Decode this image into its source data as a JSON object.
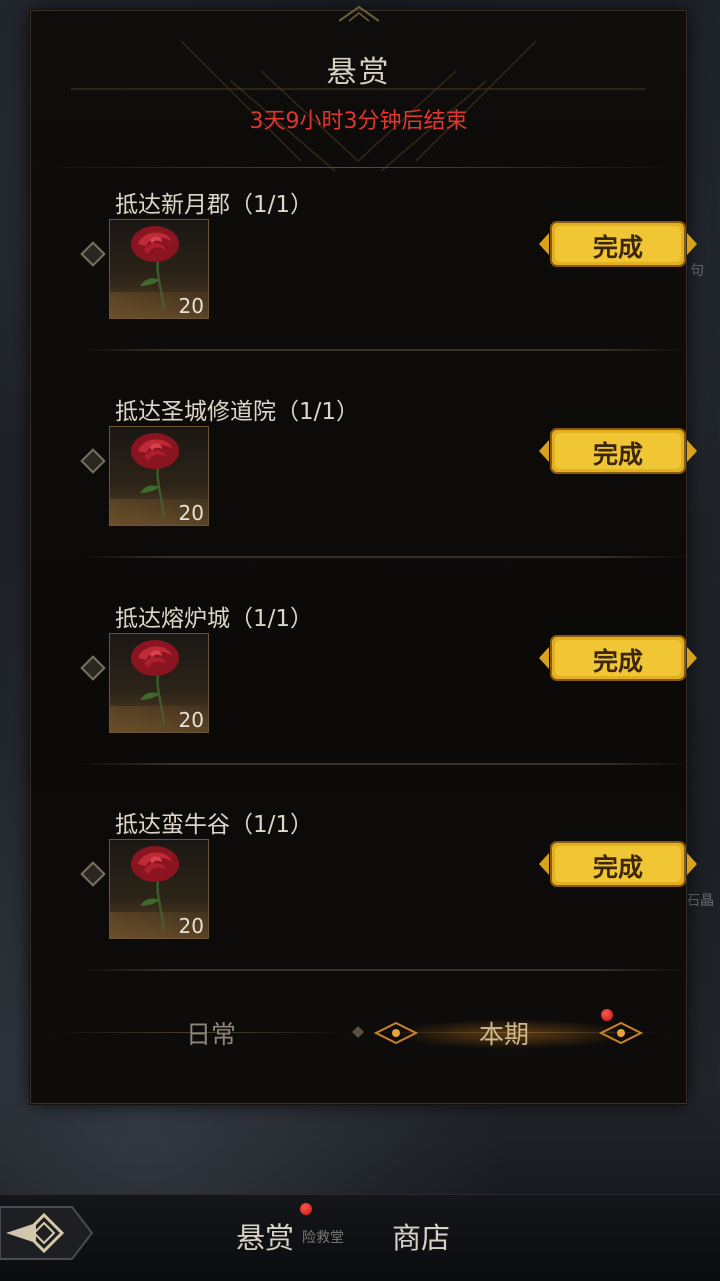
{
  "panel": {
    "title": "悬赏",
    "countdown": "3天9小时3分钟后结束"
  },
  "tasks": [
    {
      "name": "抵达新月郡（1/1）",
      "reward_qty": "20",
      "button": "完成"
    },
    {
      "name": "抵达圣城修道院（1/1）",
      "reward_qty": "20",
      "button": "完成"
    },
    {
      "name": "抵达熔炉城（1/1）",
      "reward_qty": "20",
      "button": "完成"
    },
    {
      "name": "抵达蛮牛谷（1/1）",
      "reward_qty": "20",
      "button": "完成"
    }
  ],
  "tabs": {
    "daily": "日常",
    "current": "本期"
  },
  "bottom_nav": {
    "bounty": "悬赏",
    "shop": "商店",
    "bounty_sub": "险救堂"
  },
  "background_text": {
    "right_1": "句",
    "right_2": "石晶"
  },
  "colors": {
    "countdown": "#e0362f",
    "button_gold": "#e3b020",
    "notification": "#d01818"
  }
}
